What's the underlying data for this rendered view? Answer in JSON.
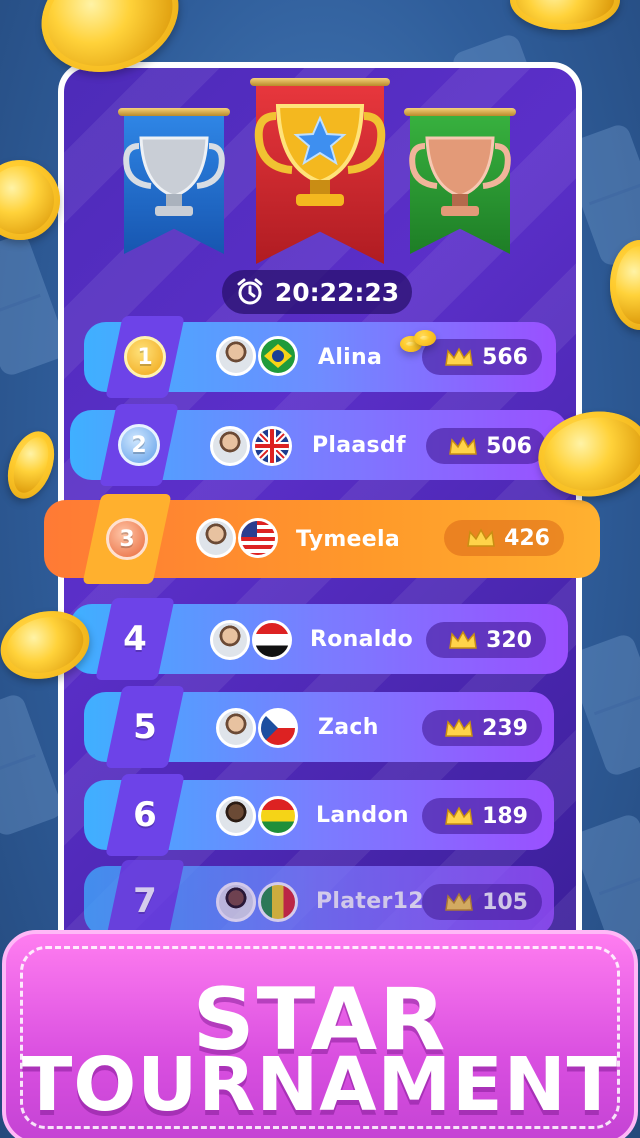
{
  "timer": {
    "value": "20:22:23",
    "icon": "alarm-clock-icon"
  },
  "trophies": [
    {
      "place": "second",
      "banner_color": "#1f6fcf",
      "trophy": "silver-trophy-icon"
    },
    {
      "place": "first",
      "banner_color": "#d8262c",
      "trophy": "gold-trophy-icon"
    },
    {
      "place": "third",
      "banner_color": "#2f9a35",
      "trophy": "bronze-trophy-icon"
    }
  ],
  "leaderboard": [
    {
      "rank": "1",
      "name": "Alina",
      "score": "566",
      "flag": "brazil-flag-icon",
      "highlight": false
    },
    {
      "rank": "2",
      "name": "Plaasdf",
      "score": "506",
      "flag": "uk-flag-icon",
      "highlight": false
    },
    {
      "rank": "3",
      "name": "Tymeela",
      "score": "426",
      "flag": "usa-flag-icon",
      "highlight": true
    },
    {
      "rank": "4",
      "name": "Ronaldo",
      "score": "320",
      "flag": "egypt-flag-icon",
      "highlight": false
    },
    {
      "rank": "5",
      "name": "Zach",
      "score": "239",
      "flag": "czech-flag-icon",
      "highlight": false
    },
    {
      "rank": "6",
      "name": "Landon",
      "score": "189",
      "flag": "bolivia-flag-icon",
      "highlight": false
    },
    {
      "rank": "7",
      "name": "Plater12",
      "score": "105",
      "flag": "senegal-flag-icon",
      "highlight": false
    }
  ],
  "title": {
    "line1": "STAR",
    "line2": "TOURNAMENT"
  },
  "colors": {
    "row_blue": "#3fa9ff",
    "row_purple": "#8a4dff",
    "highlight_orange": "#ff8a2a",
    "title_pink": "#e05be6"
  }
}
